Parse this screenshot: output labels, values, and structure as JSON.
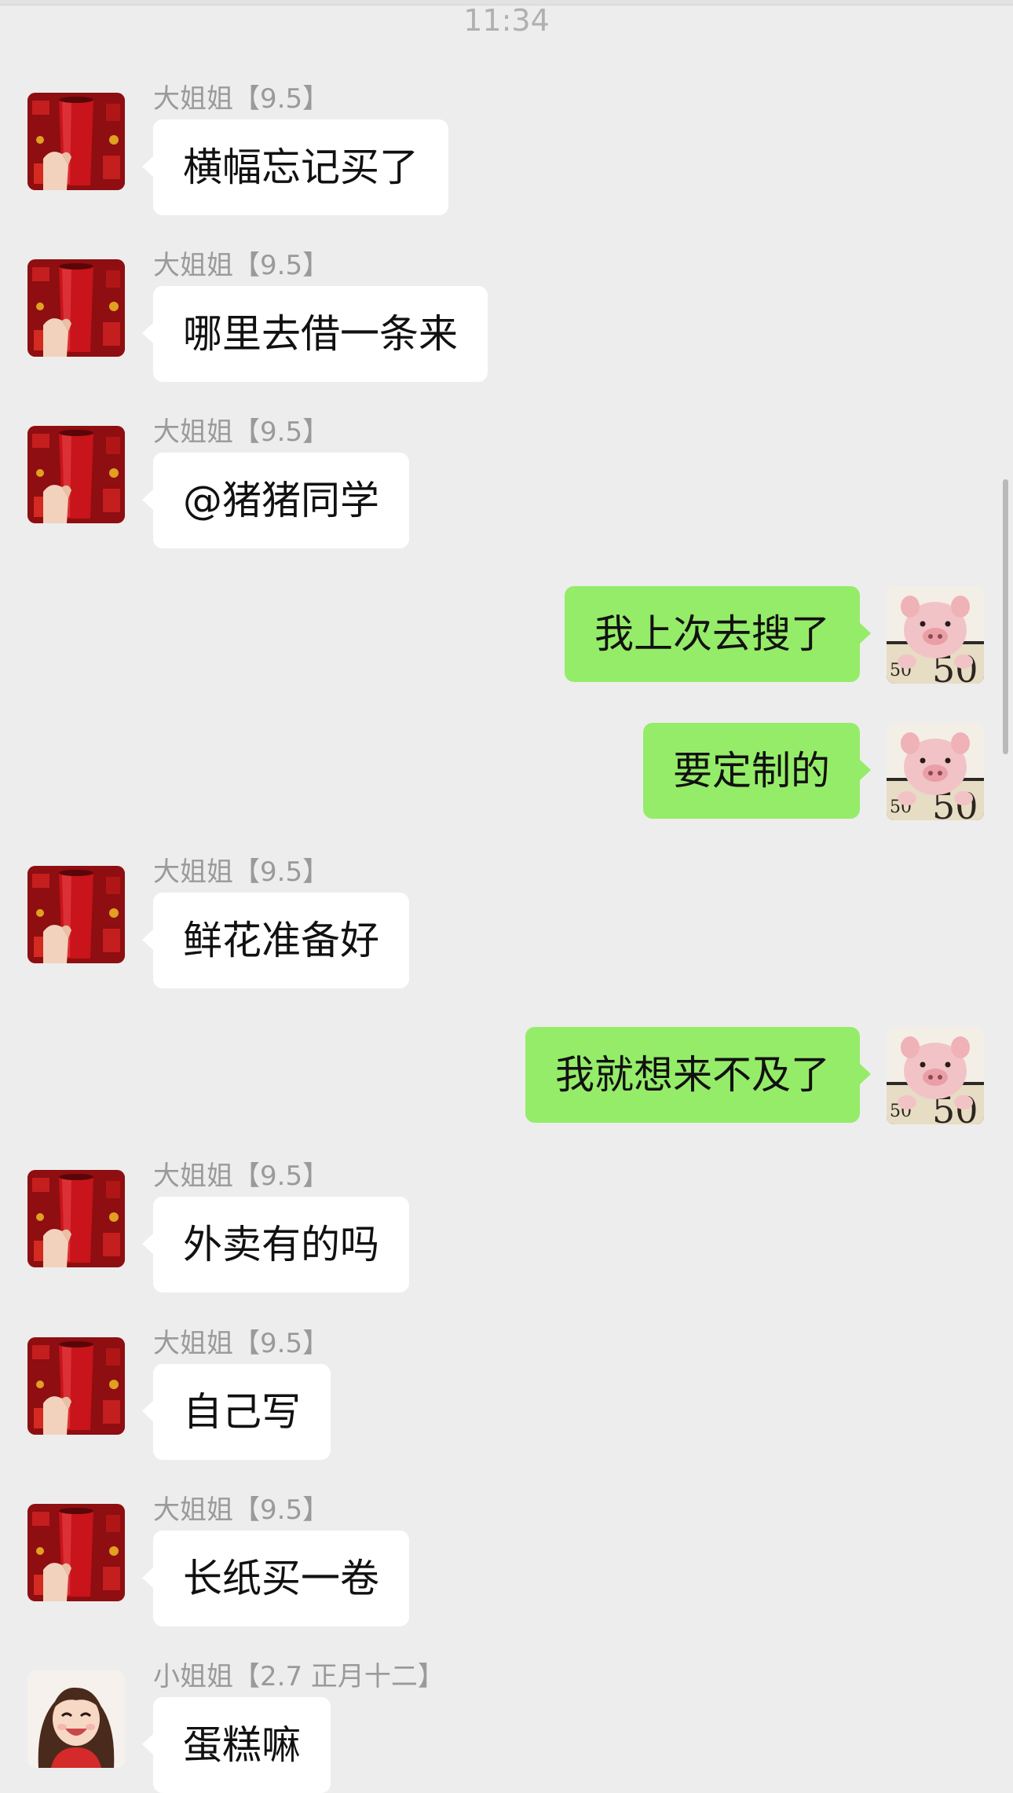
{
  "chat": {
    "timestamp": "11:34",
    "messages": [
      {
        "sender": "大姐姐【9.5】",
        "text": "横幅忘记买了"
      },
      {
        "sender": "大姐姐【9.5】",
        "text": "哪里去借一条来"
      },
      {
        "sender": "大姐姐【9.5】",
        "text": "@猪猪同学"
      },
      {
        "text": "我上次去搜了"
      },
      {
        "text": "要定制的"
      },
      {
        "sender": "大姐姐【9.5】",
        "text": "鲜花准备好"
      },
      {
        "text": "我就想来不及了"
      },
      {
        "sender": "大姐姐【9.5】",
        "text": "外卖有的吗"
      },
      {
        "sender": "大姐姐【9.5】",
        "text": "自己写"
      },
      {
        "sender": "大姐姐【9.5】",
        "text": "长纸买一卷"
      },
      {
        "sender": "小姐姐【2.7 正月十二】",
        "text": "蛋糕嘛"
      }
    ]
  },
  "colors": {
    "background": "#ededed",
    "incoming_bubble": "#ffffff",
    "outgoing_bubble": "#95ec69"
  },
  "icons": {
    "incoming_avatar": "red-cup-avatar-icon",
    "outgoing_avatar": "pig-avatar-icon",
    "last_avatar": "girl-avatar-icon"
  }
}
